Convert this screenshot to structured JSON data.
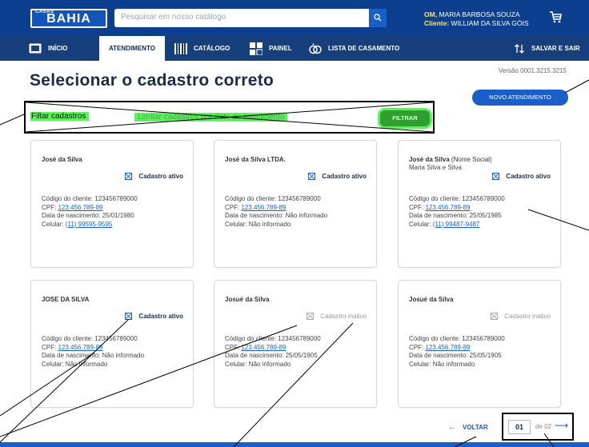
{
  "header": {
    "logo_small": "CASAS",
    "logo_main": "BAHIA",
    "search_placeholder": "Pesquisar em nosso catálogo",
    "operator_label": "OM,",
    "operator_name": "MARIA BARBOSA SOUZA",
    "client_label": "Cliente:",
    "client_name": "WILLIAM DA SILVA GÓIS"
  },
  "nav": {
    "items": [
      {
        "label": "INÍCIO",
        "icon": "home-icon"
      },
      {
        "label": "ATENDIMENTO",
        "icon": ""
      },
      {
        "label": "CATÁLOGO",
        "icon": "barcode-icon"
      },
      {
        "label": "PAINEL",
        "icon": "dashboard-icon"
      },
      {
        "label": "LISTA DE CASAMENTO",
        "icon": "rings-icon"
      }
    ],
    "save_exit": "SALVAR E SAIR"
  },
  "page": {
    "title": "Selecionar o cadastro correto",
    "version": "Versão 0001.3215.3215",
    "new_button": "NOVO ATENDIMENTO"
  },
  "filter": {
    "label": "Filtar cadastros",
    "checkbox_label": "Limitar cadastros por data de nascimento",
    "button": "FILTRAR"
  },
  "cards": [
    {
      "name": "José da Silva",
      "social": "",
      "name2": "",
      "status": "Cadastro ativo",
      "active": true,
      "code": "Código do cliente: 123456789000",
      "cpf_label": "CPF: ",
      "cpf": "123.456.789-89",
      "birth": "Data de nascimento: 25/01/1980",
      "phone_label": "Celular: ",
      "phone": "(11) 99595-9595"
    },
    {
      "name": "José da Silva LTDA.",
      "social": "",
      "name2": "",
      "status": "Cadastro ativo",
      "active": true,
      "code": "Código do cliente: 123456789000",
      "cpf_label": "CPF: ",
      "cpf": "123.456.789-89",
      "birth": "Data de nascimento: Não informado",
      "phone_label": "Celular: Não informado",
      "phone": ""
    },
    {
      "name": "José da Silva",
      "social": " (Nome Social)",
      "name2": "Maria Silva e Silva",
      "status": "Cadastro ativo",
      "active": true,
      "code": "Código do cliente: 123456789000",
      "cpf_label": "CPF: ",
      "cpf": "123.456.789-89",
      "birth": "Data de nascimento: 25/05/1985",
      "phone_label": "Celular: ",
      "phone": "(11) 99487-9487"
    },
    {
      "name": "JOSE DA SILVA",
      "social": "",
      "name2": "",
      "status": "Cadastro ativo",
      "active": true,
      "code": "Código do cliente: 123456789000",
      "cpf_label": "CPF: ",
      "cpf": "123.456.789-89",
      "birth": "Data de nascimento: Não informado",
      "phone_label": "Celular: Não informado",
      "phone": ""
    },
    {
      "name": "Josué da Silva",
      "social": "",
      "name2": "",
      "status": "Cadastro inativo",
      "active": false,
      "code": "Código do cliente: 123456789000",
      "cpf_label": "CPF: ",
      "cpf": "123.456.789-89",
      "birth": "Data de nascimento: 25/05/1905",
      "phone_label": "Celular: Não informado",
      "phone": ""
    },
    {
      "name": "Josué da Silva",
      "social": "",
      "name2": "",
      "status": "Cadastro inativo",
      "active": false,
      "code": "Código do cliente: 123456789000",
      "cpf_label": "CPF: ",
      "cpf": "123.456.789-89",
      "birth": "Data de nascimento: 25/05/1905",
      "phone_label": "Celular: Não informado",
      "phone": ""
    }
  ],
  "pagination": {
    "back": "VOLTAR",
    "current": "01",
    "of": "de 02"
  }
}
